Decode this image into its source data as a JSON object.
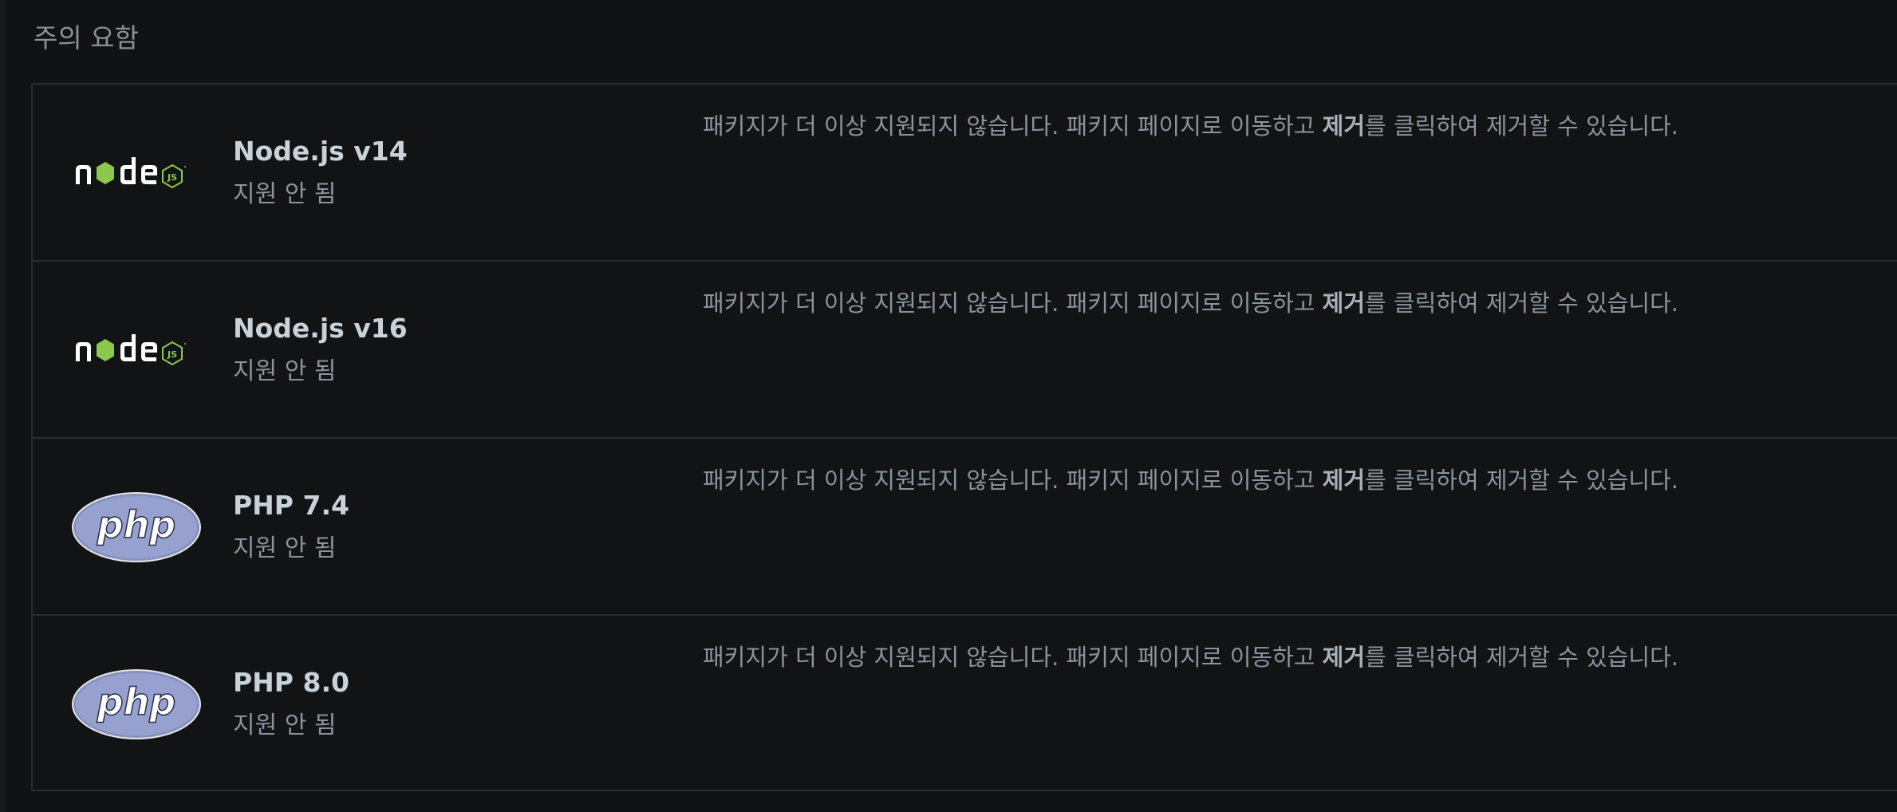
{
  "section": {
    "title": "주의 요함"
  },
  "packages": [
    {
      "logo": "nodejs-logo",
      "name": "Node.js v14",
      "status": "지원 안 됨",
      "message_before": "패키지가 더 이상 지원되지 않습니다. 패키지 페이지로 이동하고 ",
      "message_bold": "제거",
      "message_after": "를 클릭하여 제거할 수 있습니다."
    },
    {
      "logo": "nodejs-logo",
      "name": "Node.js v16",
      "status": "지원 안 됨",
      "message_before": "패키지가 더 이상 지원되지 않습니다. 패키지 페이지로 이동하고 ",
      "message_bold": "제거",
      "message_after": "를 클릭하여 제거할 수 있습니다."
    },
    {
      "logo": "php-logo",
      "name": "PHP 7.4",
      "status": "지원 안 됨",
      "message_before": "패키지가 더 이상 지원되지 않습니다. 패키지 페이지로 이동하고 ",
      "message_bold": "제거",
      "message_after": "를 클릭하여 제거할 수 있습니다."
    },
    {
      "logo": "php-logo",
      "name": "PHP 8.0",
      "status": "지원 안 됨",
      "message_before": "패키지가 더 이상 지원되지 않습니다. 패키지 페이지로 이동하고 ",
      "message_bold": "제거",
      "message_after": "를 클릭하여 제거할 수 있습니다."
    }
  ],
  "colors": {
    "background": "#111213",
    "border": "#2a2c2f",
    "name_text": "#c9d1d9",
    "muted_text": "#8b949e",
    "node_green": "#8cc84b",
    "php_purple": "#8892bf"
  }
}
